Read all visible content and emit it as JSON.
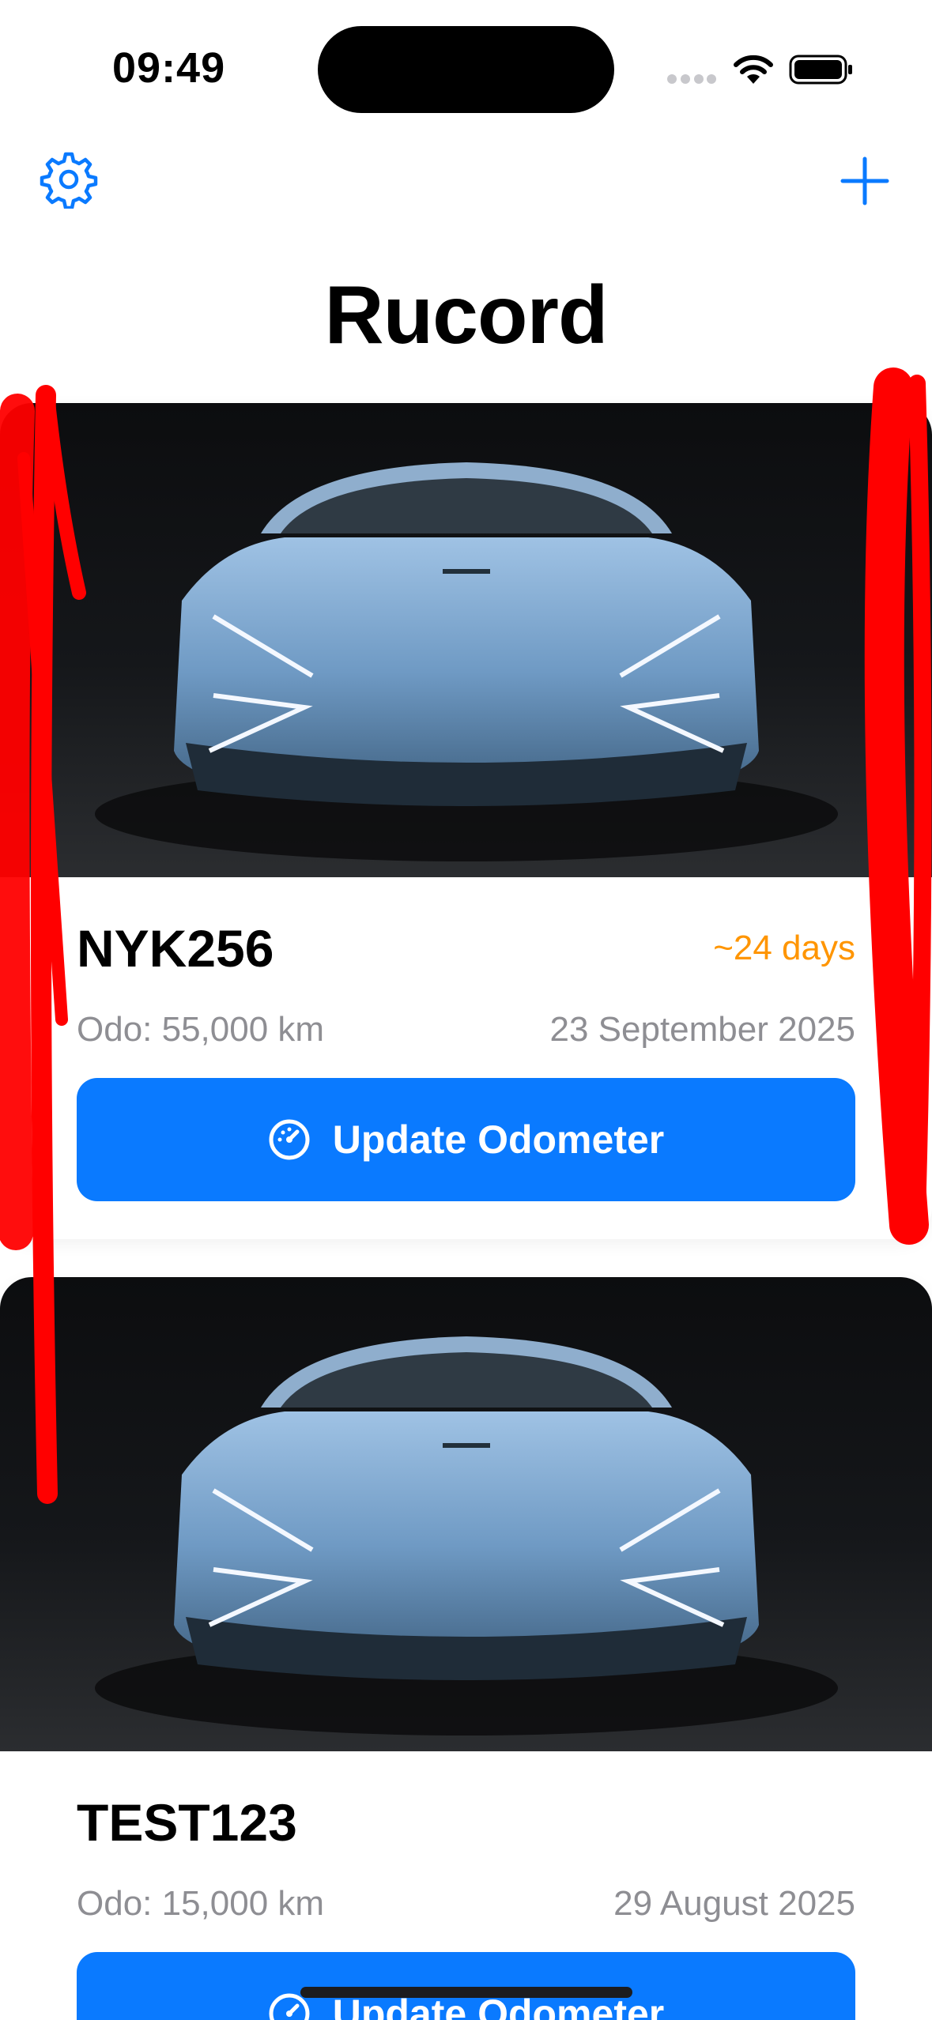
{
  "status_bar": {
    "time": "09:49"
  },
  "nav": {
    "title": "Rucord"
  },
  "vehicles": [
    {
      "plate": "NYK256",
      "eta": "~24 days",
      "odometer": "Odo: 55,000 km",
      "date": "23 September 2025",
      "button_label": "Update Odometer"
    },
    {
      "plate": "TEST123",
      "eta": "",
      "odometer": "Odo: 15,000 km",
      "date": "29 August 2025",
      "button_label": "Update Odometer"
    }
  ],
  "colors": {
    "accent": "#0a7aff",
    "eta_warning": "#FF9500",
    "secondary_text": "#8e8e93",
    "annotation_marker": "#ff0000"
  }
}
